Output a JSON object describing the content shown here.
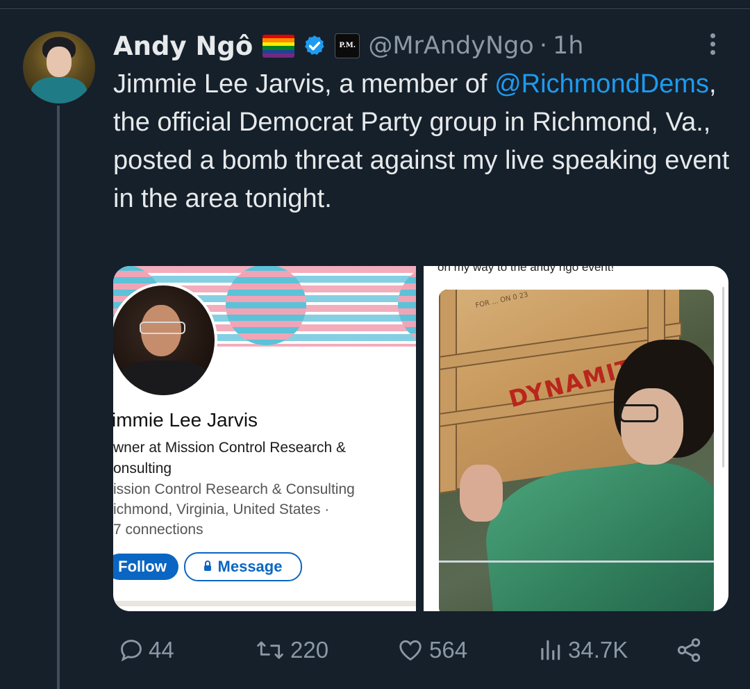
{
  "tweet": {
    "author_name": "Andy Ngô",
    "affiliation_badge": "P.M.",
    "handle": "@MrAndyNgo",
    "separator": "·",
    "time": "1h",
    "text_before": "Jimmie Lee Jarvis, a member of ",
    "mention": "@RichmondDems",
    "text_after": ", the official Democrat Party group in Richmond, Va., posted a bomb threat against my live speaking event in the area tonight.",
    "icons": [
      "rainbow-flag-icon",
      "verified-badge-icon",
      "more-options-icon"
    ]
  },
  "media": {
    "linkedin": {
      "name": "immie Lee Jarvis",
      "headline_1": "wner at Mission Control Research &",
      "headline_2": "onsulting",
      "company": "ission Control Research & Consulting",
      "location": "ichmond, Virginia, United States ·",
      "connections": "7 connections",
      "follow_label": "Follow",
      "message_label": "Message"
    },
    "post": {
      "caption": "on my way to the andy ngo event!",
      "crate_label": "DYNAMITE",
      "crate_stencil": "FOR ... ON 0 23"
    }
  },
  "actions": {
    "replies": "44",
    "reposts": "220",
    "likes": "564",
    "views": "34.7K"
  },
  "colors": {
    "background": "#15202b",
    "text": "#e7e9ea",
    "muted": "#8b98a5",
    "link": "#1d9bf0",
    "linkedin_blue": "#0a66c2"
  }
}
